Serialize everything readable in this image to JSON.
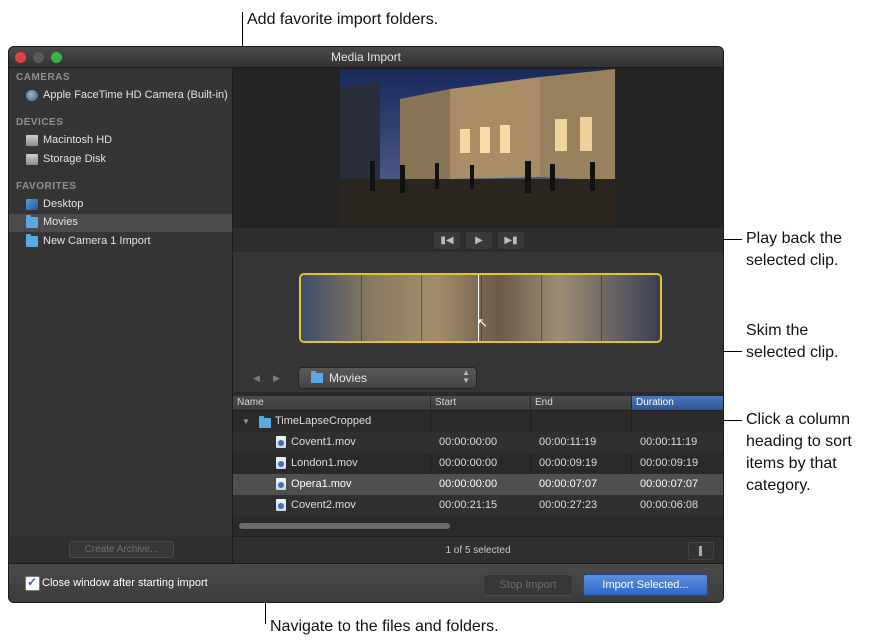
{
  "callouts": {
    "add_favorite": "Add favorite import folders.",
    "play_back_1": "Play back the",
    "play_back_2": "selected clip.",
    "skim_1": "Skim the",
    "skim_2": "selected clip.",
    "column_1": "Click a column",
    "column_2": "heading to sort",
    "column_3": "items by that",
    "column_4": "category.",
    "navigate": "Navigate to the files and folders."
  },
  "window": {
    "title": "Media Import"
  },
  "sidebar": {
    "sections": [
      {
        "heading": "CAMERAS",
        "items": [
          {
            "label": "Apple FaceTime HD Camera (Built-in)",
            "icon": "camera-icon"
          }
        ]
      },
      {
        "heading": "DEVICES",
        "items": [
          {
            "label": "Macintosh HD",
            "icon": "disk-icon"
          },
          {
            "label": "Storage Disk",
            "icon": "disk-icon"
          }
        ]
      },
      {
        "heading": "FAVORITES",
        "items": [
          {
            "label": "Desktop",
            "icon": "desktop-folder-icon"
          },
          {
            "label": "Movies",
            "icon": "folder-icon",
            "selected": true
          },
          {
            "label": "New Camera 1 Import",
            "icon": "folder-icon"
          }
        ]
      }
    ],
    "create_archive": "Create Archive..."
  },
  "browser": {
    "location": "Movies",
    "columns": {
      "name": "Name",
      "start": "Start",
      "end": "End",
      "duration": "Duration"
    },
    "folder": "TimeLapseCropped",
    "rows": [
      {
        "name": "Covent1.mov",
        "start": "00:00:00:00",
        "end": "00:00:11:19",
        "duration": "00:00:11:19"
      },
      {
        "name": "London1.mov",
        "start": "00:00:00:00",
        "end": "00:00:09:19",
        "duration": "00:00:09:19"
      },
      {
        "name": "Opera1.mov",
        "start": "00:00:00:00",
        "end": "00:00:07:07",
        "duration": "00:00:07:07",
        "selected": true
      },
      {
        "name": "Covent2.mov",
        "start": "00:00:21:15",
        "end": "00:00:27:23",
        "duration": "00:00:06:08"
      }
    ],
    "status": "1 of 5 selected"
  },
  "footer": {
    "close_after_import": "Close window after starting import",
    "stop_import": "Stop Import",
    "import_selected": "Import Selected..."
  },
  "colors": {
    "selection_border": "#e3c52b",
    "primary_button": "#2d66c5",
    "active_column": "#2e5896"
  }
}
